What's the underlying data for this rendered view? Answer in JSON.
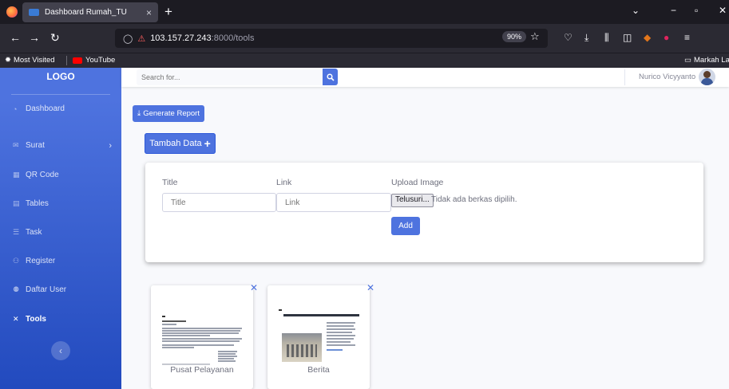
{
  "browser": {
    "tab_title": "Dashboard Rumah_TU",
    "tab_close": "×",
    "new_tab": "+",
    "url_host": "103.157.27.243",
    "url_path": ":8000/tools",
    "zoom": "90%",
    "bookmarks": {
      "most_visited": "Most Visited",
      "youtube": "YouTube",
      "right_folder": "Markah Lain"
    }
  },
  "sidebar": {
    "logo": "LOGO",
    "items": [
      {
        "label": "Dashboard",
        "icon": "dashboard-icon",
        "active": false
      },
      {
        "label": "Surat",
        "icon": "mail-icon",
        "active": false,
        "has_children": true
      },
      {
        "label": "QR Code",
        "icon": "qr-icon",
        "active": false
      },
      {
        "label": "Tables",
        "icon": "table-icon",
        "active": false
      },
      {
        "label": "Task",
        "icon": "list-icon",
        "active": false
      },
      {
        "label": "Register",
        "icon": "user-plus-icon",
        "active": false
      },
      {
        "label": "Daftar User",
        "icon": "users-icon",
        "active": false
      },
      {
        "label": "Tools",
        "icon": "tools-icon",
        "active": true
      }
    ]
  },
  "topbar": {
    "search_placeholder": "Search for...",
    "user_name": "Nurico Vicyyanto"
  },
  "actions": {
    "generate_report": "Generate Report",
    "tambah_data": "Tambah Data"
  },
  "form": {
    "title_label": "Title",
    "title_placeholder": "Title",
    "link_label": "Link",
    "link_placeholder": "Link",
    "upload_label": "Upload Image",
    "browse_button": "Telusuri...",
    "no_file_text": "Tidak ada berkas dipilih.",
    "add_button": "Add"
  },
  "cards": [
    {
      "caption": "Pusat Pelayanan"
    },
    {
      "caption": "Berita"
    }
  ],
  "colors": {
    "primary": "#4e73df",
    "sidebar_bottom": "#224abe",
    "browser_dark": "#1c1b22"
  }
}
